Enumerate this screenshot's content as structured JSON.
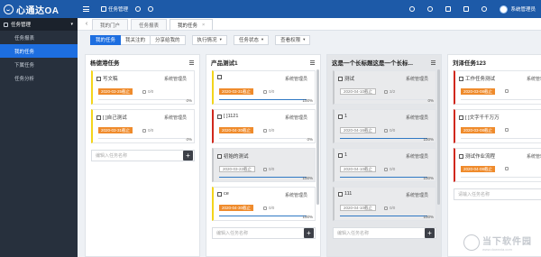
{
  "app": {
    "logo_text": "心通达OA"
  },
  "topnav": {
    "items": [
      {
        "label": "任务管理",
        "icon": "grid-icon"
      },
      {
        "label": "",
        "icon": "clock-icon"
      },
      {
        "label": "",
        "icon": "user-icon"
      }
    ]
  },
  "topright": {
    "icons": [
      "bell-icon",
      "people-icon",
      "tag-icon",
      "mail-icon",
      "gear-icon"
    ],
    "user_name": "系统管理员"
  },
  "sidebar": {
    "header": "任务管理",
    "items": [
      {
        "label": "任务报表",
        "active": false
      },
      {
        "label": "我的任务",
        "active": true
      },
      {
        "label": "下属任务",
        "active": false
      },
      {
        "label": "任务分析",
        "active": false
      }
    ]
  },
  "tabs": [
    {
      "label": "我的门户",
      "active": false
    },
    {
      "label": "任务报表",
      "active": false
    },
    {
      "label": "我的任务",
      "active": true
    }
  ],
  "filters": {
    "group": [
      "我的任务",
      "我关注的",
      "分享给我的"
    ],
    "dropdowns": [
      "执行情况",
      "任务状态",
      "查看权限"
    ]
  },
  "columns": [
    {
      "title": "杨德港任务",
      "grey": false,
      "cards": [
        {
          "title": "写文稿",
          "owner": "系统管理员",
          "date": "2020-03-25截止",
          "meta": "0/0",
          "pct": "0%",
          "progress": 0.0,
          "border": "yellow",
          "grey": false
        },
        {
          "title": "[ ]自己测试",
          "owner": "系统管理员",
          "date": "2020-03-31截止",
          "meta": "0/0",
          "pct": "0%",
          "progress": 0.0,
          "border": "yellow",
          "grey": false
        }
      ],
      "add_placeholder": "编辑入任务名称"
    },
    {
      "title": "产品测试1",
      "grey": false,
      "cards": [
        {
          "title": "",
          "owner": "系统管理员",
          "date": "2020-03-31截止",
          "meta": "0/0",
          "pct": "100%",
          "progress": 1.0,
          "border": "yellow",
          "grey": false
        },
        {
          "title": "[ ]1121",
          "owner": "系统管理员",
          "date": "2020-04-30截止",
          "meta": "0/0",
          "pct": "0%",
          "progress": 0.0,
          "border": "red",
          "grey": false
        },
        {
          "title": "初始的测试",
          "owner": "",
          "date": "2020-03-22截止",
          "meta": "0/0",
          "pct": "100%",
          "progress": 1.0,
          "border": "grey",
          "grey": true
        },
        {
          "title": "ce",
          "owner": "系统管理员",
          "date": "2020-04-30截止",
          "meta": "0/0",
          "pct": "100%",
          "progress": 1.0,
          "border": "yellow",
          "grey": false
        }
      ],
      "add_placeholder": "编辑入任务名称"
    },
    {
      "title": "这是一个长标题这是一个长标...",
      "grey": true,
      "cards": [
        {
          "title": "测试",
          "owner": "系统管理员",
          "date": "2020-04-10截止",
          "meta": "3/2",
          "pct": "0%",
          "progress": 0.0,
          "border": "grey",
          "grey": true
        },
        {
          "title": "1",
          "owner": "系统管理员",
          "date": "2020-04-16截止",
          "meta": "0/0",
          "pct": "100%",
          "progress": 1.0,
          "border": "grey",
          "grey": true
        },
        {
          "title": "1",
          "owner": "系统管理员",
          "date": "2020-04-10截止",
          "meta": "0/0",
          "pct": "100%",
          "progress": 1.0,
          "border": "grey",
          "grey": true
        },
        {
          "title": "111",
          "owner": "系统管理员",
          "date": "2020-04-10截止",
          "meta": "0/0",
          "pct": "100%",
          "progress": 1.0,
          "border": "grey",
          "grey": true
        }
      ],
      "add_placeholder": "编辑入任务名称"
    },
    {
      "title": "刘泽任务123",
      "grey": false,
      "cards": [
        {
          "title": "工作任务测试",
          "owner": "系统管理员",
          "date": "2020-03-08截止",
          "meta": "",
          "pct": "0%",
          "progress": 0.0,
          "border": "red",
          "grey": false
        },
        {
          "title": "[ ]文字千千万万",
          "owner": "",
          "date": "2020-03-08截止",
          "meta": "",
          "pct": "0%",
          "progress": 0.0,
          "border": "red",
          "grey": false
        },
        {
          "title": "测试作业流程",
          "owner": "系统管理员",
          "date": "2020-04-08截止",
          "meta": "",
          "pct": "0%",
          "progress": 0.0,
          "border": "red",
          "grey": false
        }
      ],
      "add_placeholder": "请输入任务名称"
    }
  ],
  "watermark": {
    "text": "当下软件园",
    "url": "www.downxia.com"
  }
}
